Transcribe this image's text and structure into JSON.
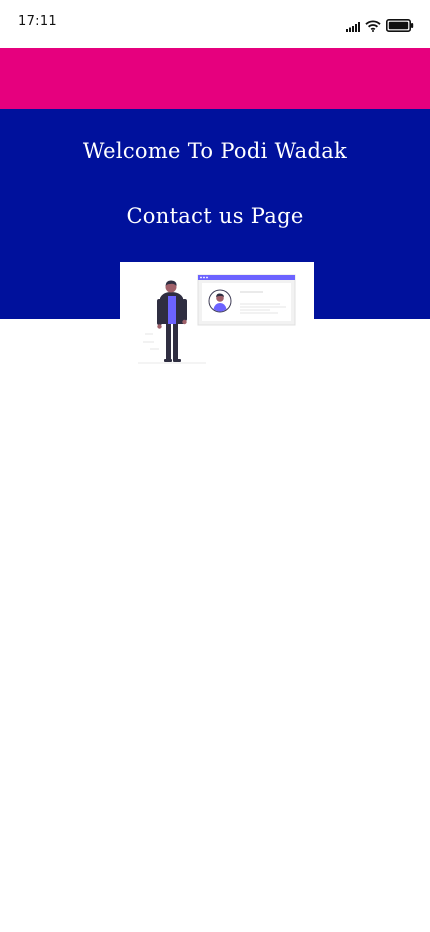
{
  "status_bar": {
    "time": "17:11",
    "icons": [
      "signal-icon",
      "wifi-icon",
      "battery-icon"
    ]
  },
  "colors": {
    "accent_pink": "#E6007E",
    "banner_blue": "#00119C",
    "illustration_purple": "#6C63FF"
  },
  "header": {
    "welcome": "Welcome To Podi Wadak",
    "page_title": "Contact us Page"
  },
  "illustration": {
    "name": "contact-person-illustration"
  }
}
